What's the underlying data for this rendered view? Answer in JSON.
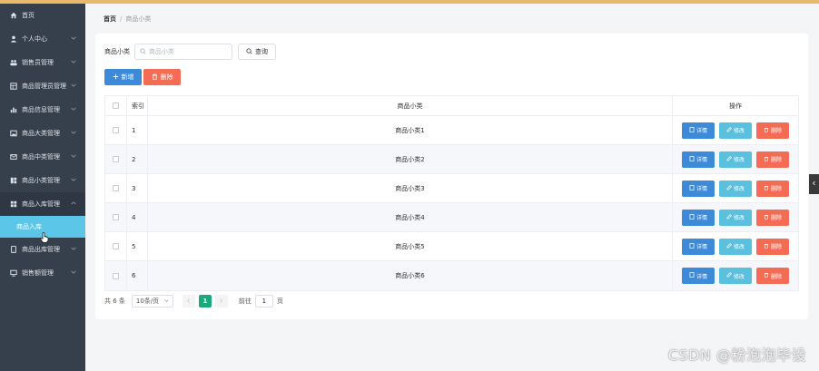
{
  "sidebar": {
    "items": [
      {
        "label": "首页",
        "icon": "home-icon",
        "chevron": false
      },
      {
        "label": "个人中心",
        "icon": "user-icon",
        "chevron": true
      },
      {
        "label": "销售员管理",
        "icon": "people-icon",
        "chevron": true
      },
      {
        "label": "商品管理员管理",
        "icon": "table-icon",
        "chevron": true
      },
      {
        "label": "商品信息管理",
        "icon": "bar-chart-icon",
        "chevron": true
      },
      {
        "label": "商品大类管理",
        "icon": "picture-icon",
        "chevron": true
      },
      {
        "label": "商品中类管理",
        "icon": "mail-icon",
        "chevron": true
      },
      {
        "label": "商品小类管理",
        "icon": "dashboard-icon",
        "chevron": true
      },
      {
        "label": "商品入库管理",
        "icon": "grid-icon",
        "chevron": true,
        "expanded": true
      },
      {
        "label": "商品出库管理",
        "icon": "phone-icon",
        "chevron": true
      },
      {
        "label": "销售额管理",
        "icon": "monitor-icon",
        "chevron": true
      }
    ],
    "submenu_label": "商品入库"
  },
  "breadcrumb": {
    "home": "首页",
    "separator": "/",
    "current": "商品小类"
  },
  "search": {
    "label": "商品小类",
    "placeholder": "商品小类",
    "button_label": "查询"
  },
  "actions": {
    "add_label": "新增",
    "delete_label": "删除"
  },
  "table": {
    "headers": {
      "index": "索引",
      "name": "商品小类",
      "ops": "操作"
    },
    "rows": [
      {
        "index": "1",
        "name": "商品小类1"
      },
      {
        "index": "2",
        "name": "商品小类2"
      },
      {
        "index": "3",
        "name": "商品小类3"
      },
      {
        "index": "4",
        "name": "商品小类4"
      },
      {
        "index": "5",
        "name": "商品小类5"
      },
      {
        "index": "6",
        "name": "商品小类6"
      }
    ],
    "ops": {
      "detail": "详情",
      "edit": "修改",
      "delete": "删除"
    }
  },
  "pagination": {
    "total": "共 6 条",
    "page_size": "10条/页",
    "current_page": "1",
    "goto_label": "前往",
    "goto_value": "1",
    "unit": "页"
  },
  "watermark": "CSDN @粉泡泡毕设",
  "colors": {
    "sidebar_bg": "#363f4c",
    "submenu_active": "#5bc6e8",
    "primary": "#3d8bd8",
    "info": "#5bc0de",
    "danger": "#f56c54",
    "pager_active": "#1aa97b",
    "top_accent": "#e8b96b"
  }
}
